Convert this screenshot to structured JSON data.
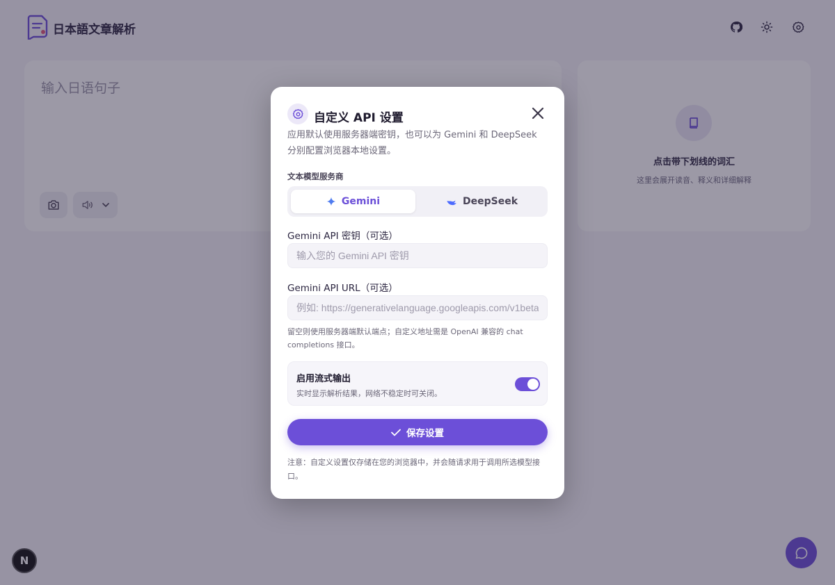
{
  "app": {
    "title": "日本語文章解析",
    "header_icons": [
      "github-icon",
      "sun-icon",
      "gear-icon"
    ]
  },
  "input_card": {
    "placeholder": "输入日语句子"
  },
  "detail_card": {
    "title": "点击带下划线的词汇",
    "subtitle": "这里会展开读音、释义和详细解释"
  },
  "badge": {
    "letter": "N"
  },
  "modal": {
    "title": "自定义 API 设置",
    "description": "应用默认使用服务器端密钥，也可以为 Gemini 和 DeepSeek 分别配置浏览器本地设置。",
    "provider_label": "文本模型服务商",
    "providers": [
      {
        "label": "Gemini",
        "active": true
      },
      {
        "label": "DeepSeek",
        "active": false
      }
    ],
    "key_label": "Gemini API 密钥（可选）",
    "key_placeholder": "输入您的 Gemini API 密钥",
    "key_value": "",
    "url_label": "Gemini API URL（可选）",
    "url_placeholder": "例如: https://generativelanguage.googleapis.com/v1beta/",
    "url_value": "",
    "url_hint": "留空则使用服务器端默认端点；自定义地址需是 OpenAI 兼容的 chat completions 接口。",
    "stream": {
      "title": "启用流式输出",
      "subtitle": "实时显示解析结果，网络不稳定时可关闭。",
      "enabled": true
    },
    "save_label": "保存设置",
    "note": "注意：自定义设置仅存储在您的浏览器中，并会随请求用于调用所选模型接口。"
  },
  "colors": {
    "accent": "#6c4fd8",
    "overlay": "#28203c"
  }
}
